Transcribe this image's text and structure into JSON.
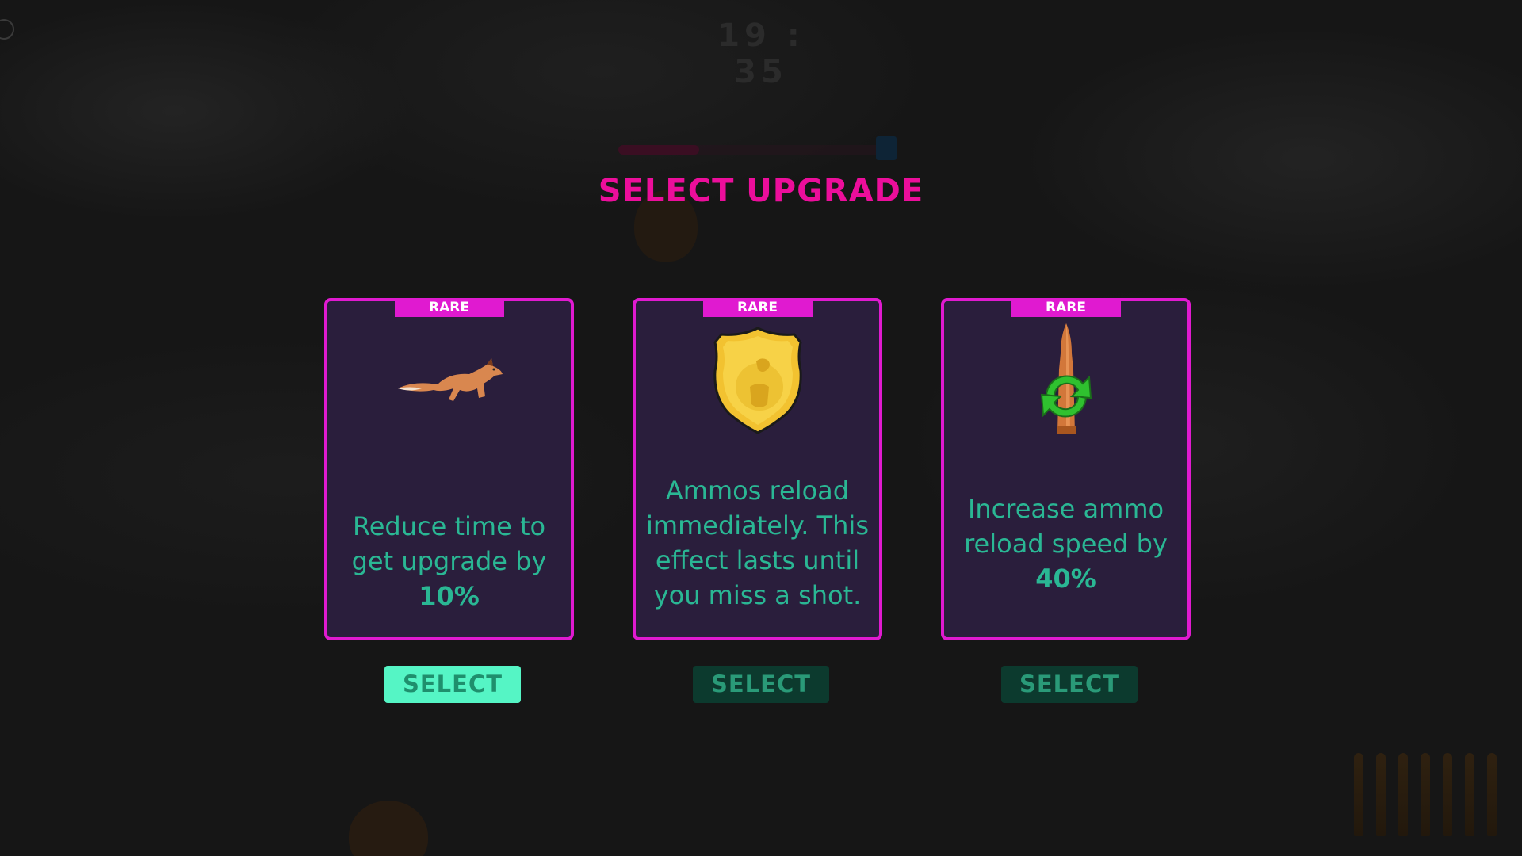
{
  "hud": {
    "timer": "19 : 35",
    "upgrade_progress_fraction": 0.3
  },
  "overlay": {
    "title": "SELECT UPGRADE"
  },
  "cards": [
    {
      "rarity": "RARE",
      "icon": "running-fox-icon",
      "desc_prefix": "Reduce time to get upgrade by ",
      "desc_value": "10%",
      "desc_suffix": "",
      "button_label": "SELECT",
      "highlighted": true
    },
    {
      "rarity": "RARE",
      "icon": "gold-acorn-shield-icon",
      "desc_prefix": "Ammos reload immediately. This effect lasts until you miss a shot.",
      "desc_value": "",
      "desc_suffix": "",
      "button_label": "SELECT",
      "highlighted": false
    },
    {
      "rarity": "RARE",
      "icon": "bullet-reload-icon",
      "desc_prefix": "Increase ammo reload speed by ",
      "desc_value": "40%",
      "desc_suffix": "",
      "button_label": "SELECT",
      "highlighted": false
    }
  ],
  "colors": {
    "title": "#ec0e9b",
    "card_border": "#e01ad0",
    "card_bg": "#2a1e3c",
    "desc_text": "#2ab794",
    "button_active_bg": "#55f5c5",
    "button_bg": "#0c3a2e"
  }
}
